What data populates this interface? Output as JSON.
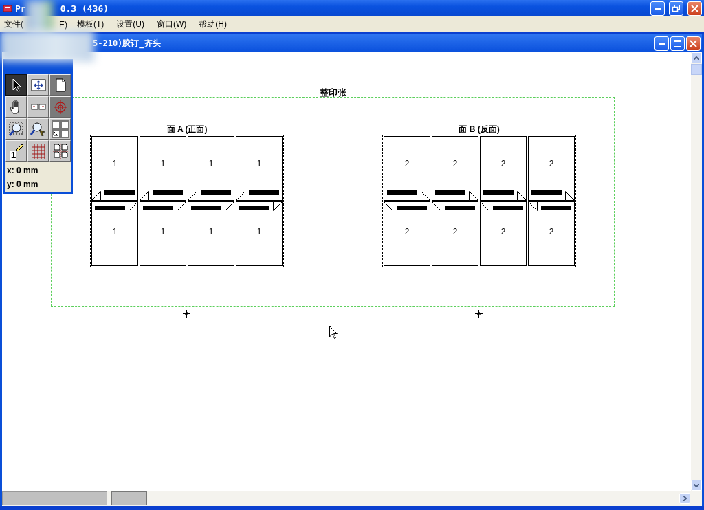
{
  "app": {
    "title_start": "Pr",
    "title_end": "0.3 (436)"
  },
  "menu": [
    {
      "label": "文件("
    },
    {
      "label": "E)"
    },
    {
      "label": "模板(T)"
    },
    {
      "label": "设置(U)"
    },
    {
      "label": "窗口(W)"
    },
    {
      "label": "帮助(H)"
    }
  ],
  "document": {
    "title": "5-210)胶订_齐头"
  },
  "toolbox": {
    "tools": [
      {
        "kind": "pointer",
        "selected": true
      },
      {
        "kind": "move",
        "selected": false
      },
      {
        "kind": "page",
        "selected": false
      },
      {
        "kind": "hand",
        "selected": false
      },
      {
        "kind": "marks",
        "selected": false
      },
      {
        "kind": "target",
        "selected": false
      },
      {
        "kind": "zoom",
        "selected": false
      },
      {
        "kind": "zoom-pick",
        "selected": false
      },
      {
        "kind": "panels",
        "selected": false
      },
      {
        "kind": "number",
        "selected": false
      },
      {
        "kind": "grid",
        "selected": false
      },
      {
        "kind": "imposition",
        "selected": false
      }
    ],
    "number_label": "1",
    "x_reading": "x: 0 mm",
    "y_reading": "y: 0 mm"
  },
  "sheet": {
    "title": "整印张",
    "faces": [
      {
        "label": "面 A (正面)",
        "kind": "front",
        "rows": [
          {
            "kind": "mark-bottom",
            "pages": [
              "1",
              "1",
              "1",
              "1"
            ]
          },
          {
            "kind": "mark-top",
            "pages": [
              "1",
              "1",
              "1",
              "1"
            ]
          }
        ]
      },
      {
        "label": "面 B (反面)",
        "kind": "back",
        "rows": [
          {
            "kind": "mark-bottom",
            "pages": [
              "2",
              "2",
              "2",
              "2"
            ]
          },
          {
            "kind": "mark-top",
            "pages": [
              "2",
              "2",
              "2",
              "2"
            ]
          }
        ]
      }
    ]
  }
}
